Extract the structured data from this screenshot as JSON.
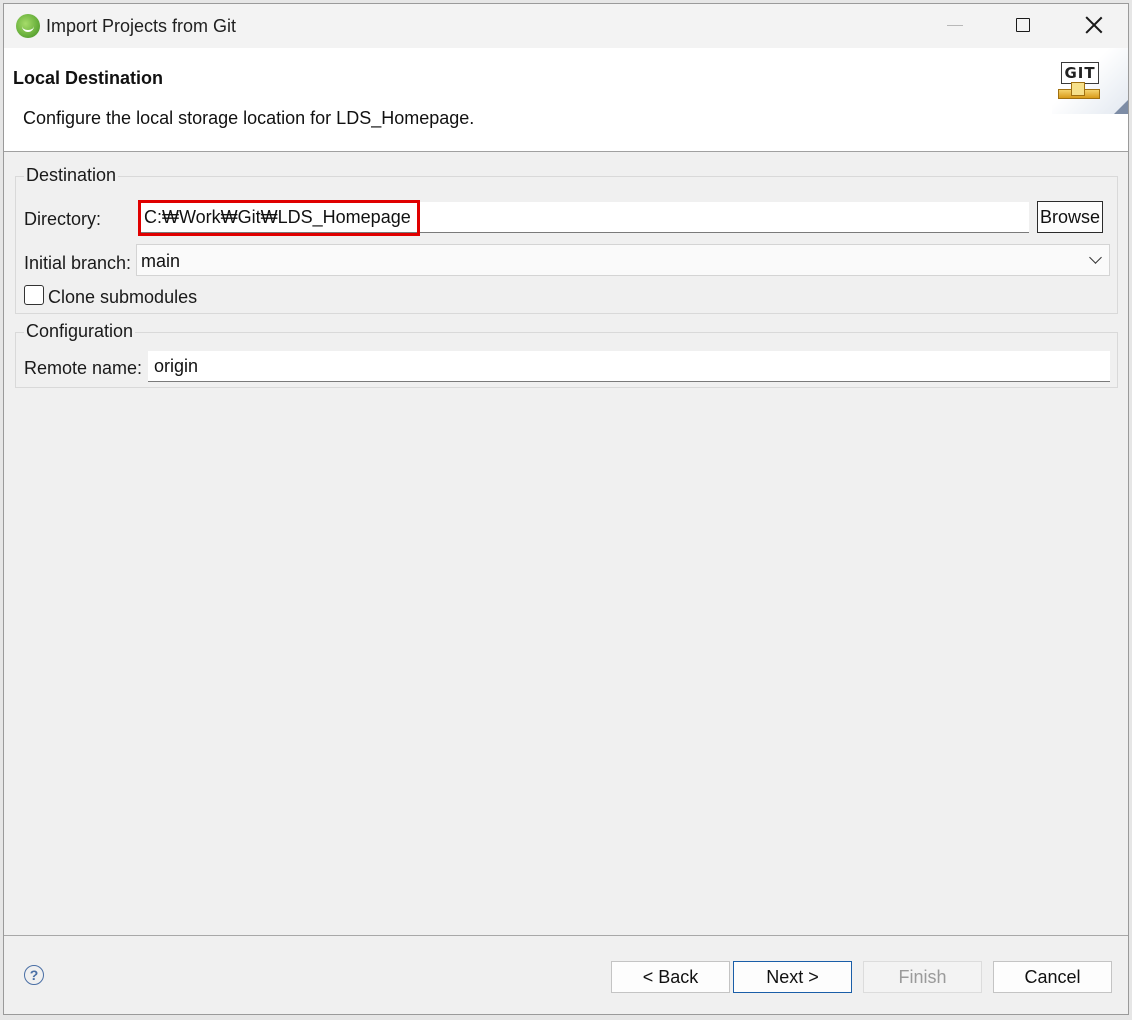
{
  "window": {
    "title": "Import Projects from Git",
    "icon": "spring-leaf-icon"
  },
  "header": {
    "title": "Local Destination",
    "description": "Configure the local storage location for LDS_Homepage.",
    "logo_text": "GIT"
  },
  "destination": {
    "legend": "Destination",
    "directory_label": "Directory:",
    "directory_value": "C:₩Work₩Git₩LDS_Homepage",
    "browse_label": "Browse",
    "branch_label": "Initial branch:",
    "branch_value": "main",
    "clone_submodules_label": "Clone submodules",
    "clone_submodules_checked": false
  },
  "configuration": {
    "legend": "Configuration",
    "remote_name_label": "Remote name:",
    "remote_name_value": "origin"
  },
  "footer": {
    "help_glyph": "?",
    "back_label": "< Back",
    "next_label": "Next >",
    "finish_label": "Finish",
    "cancel_label": "Cancel"
  },
  "colors": {
    "highlight_box": "#e00000",
    "default_button_border": "#1a5ea8"
  }
}
